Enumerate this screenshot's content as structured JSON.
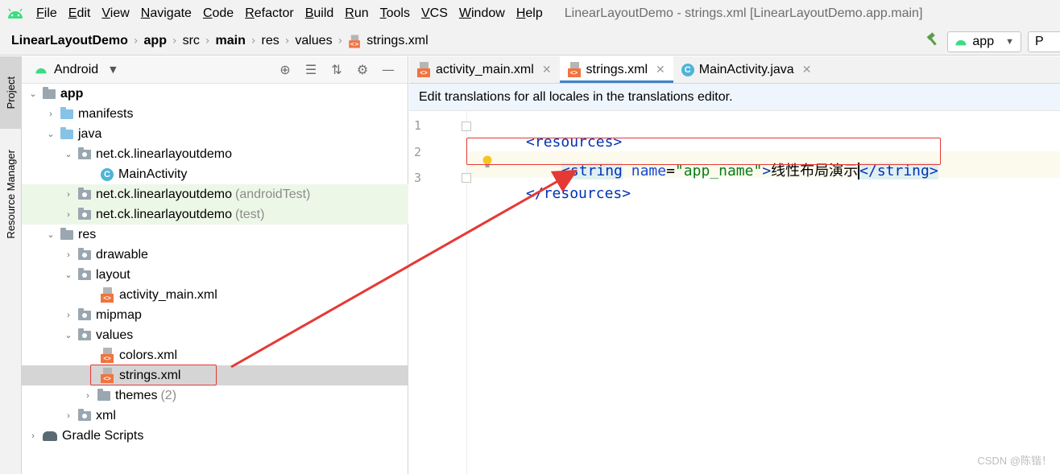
{
  "menu": {
    "items": [
      "File",
      "Edit",
      "View",
      "Navigate",
      "Code",
      "Refactor",
      "Build",
      "Run",
      "Tools",
      "VCS",
      "Window",
      "Help"
    ],
    "window_title": "LinearLayoutDemo - strings.xml [LinearLayoutDemo.app.main]"
  },
  "navbar": {
    "crumbs": [
      "LinearLayoutDemo",
      "app",
      "src",
      "main",
      "res",
      "values",
      "strings.xml"
    ],
    "run_config": "app",
    "device_partial": "P"
  },
  "tool_strip": {
    "project": "Project",
    "resource_manager": "Resource Manager"
  },
  "project_panel": {
    "view": "Android",
    "tree": [
      {
        "label": "app",
        "suffix": ""
      },
      {
        "label": "manifests",
        "suffix": ""
      },
      {
        "label": "java",
        "suffix": ""
      },
      {
        "label": "net.ck.linearlayoutdemo",
        "suffix": ""
      },
      {
        "label": "MainActivity",
        "suffix": ""
      },
      {
        "label": "net.ck.linearlayoutdemo",
        "suffix": "(androidTest)"
      },
      {
        "label": "net.ck.linearlayoutdemo",
        "suffix": "(test)"
      },
      {
        "label": "res",
        "suffix": ""
      },
      {
        "label": "drawable",
        "suffix": ""
      },
      {
        "label": "layout",
        "suffix": ""
      },
      {
        "label": "activity_main.xml",
        "suffix": ""
      },
      {
        "label": "mipmap",
        "suffix": ""
      },
      {
        "label": "values",
        "suffix": ""
      },
      {
        "label": "colors.xml",
        "suffix": ""
      },
      {
        "label": "strings.xml",
        "suffix": ""
      },
      {
        "label": "themes",
        "suffix": "(2)"
      },
      {
        "label": "xml",
        "suffix": ""
      },
      {
        "label": "Gradle Scripts",
        "suffix": ""
      }
    ]
  },
  "editor": {
    "tabs": [
      {
        "label": "activity_main.xml"
      },
      {
        "label": "strings.xml"
      },
      {
        "label": "MainActivity.java"
      }
    ],
    "banner": "Edit translations for all locales in the translations editor.",
    "line_numbers": [
      "1",
      "2",
      "3"
    ],
    "code": {
      "l1_tag": "<resources>",
      "l2_open": "<string",
      "l2_attr": "name",
      "l2_eq": "=",
      "l2_val": "\"app_name\"",
      "l2_gt": ">",
      "l2_text": "线性布局演示",
      "l2_close": "</string>",
      "l3_tag": "</resources>"
    }
  },
  "colors": {
    "annotation_red": "#e53935",
    "tab_active_underline": "#4083c9"
  },
  "watermark": "CSDN @陈锴！"
}
